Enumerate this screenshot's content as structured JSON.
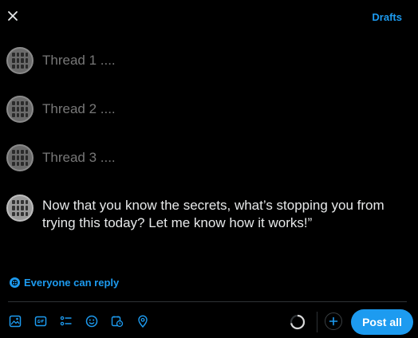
{
  "header": {
    "drafts_label": "Drafts"
  },
  "threads": [
    {
      "text": "Thread 1 ...."
    },
    {
      "text": "Thread 2 ...."
    },
    {
      "text": "Thread 3 ...."
    }
  ],
  "final_post": {
    "text": "Now that you know the secrets, what’s stopping you from trying this today? Let me know how it works!”"
  },
  "reply_setting": {
    "label": "Everyone can reply"
  },
  "toolbar": {
    "icons": [
      "image-icon",
      "gif-icon",
      "poll-icon",
      "emoji-icon",
      "schedule-icon",
      "location-icon"
    ]
  },
  "composer": {
    "post_all_label": "Post all"
  },
  "colors": {
    "accent": "#1d9bf0",
    "background": "#000000",
    "muted_text": "#777777"
  }
}
